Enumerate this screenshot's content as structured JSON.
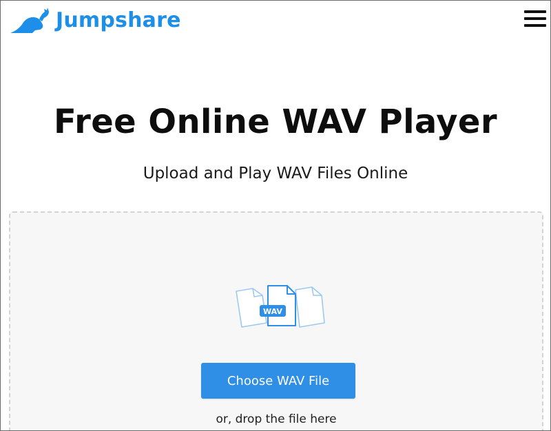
{
  "header": {
    "logo_text": "Jumpshare",
    "logo_icon": "kangaroo-icon",
    "menu_icon": "hamburger-menu-icon"
  },
  "hero": {
    "title": "Free Online WAV Player",
    "subtitle": "Upload and Play WAV Files Online"
  },
  "upload": {
    "file_badge": "WAV",
    "button_label": "Choose WAV File",
    "drop_hint": "or, drop the file here"
  },
  "colors": {
    "brand": "#1e8fe8",
    "button": "#2f8fe6",
    "dropzone_bg": "#f7f7f7",
    "dropzone_border": "#d3d3d3"
  }
}
